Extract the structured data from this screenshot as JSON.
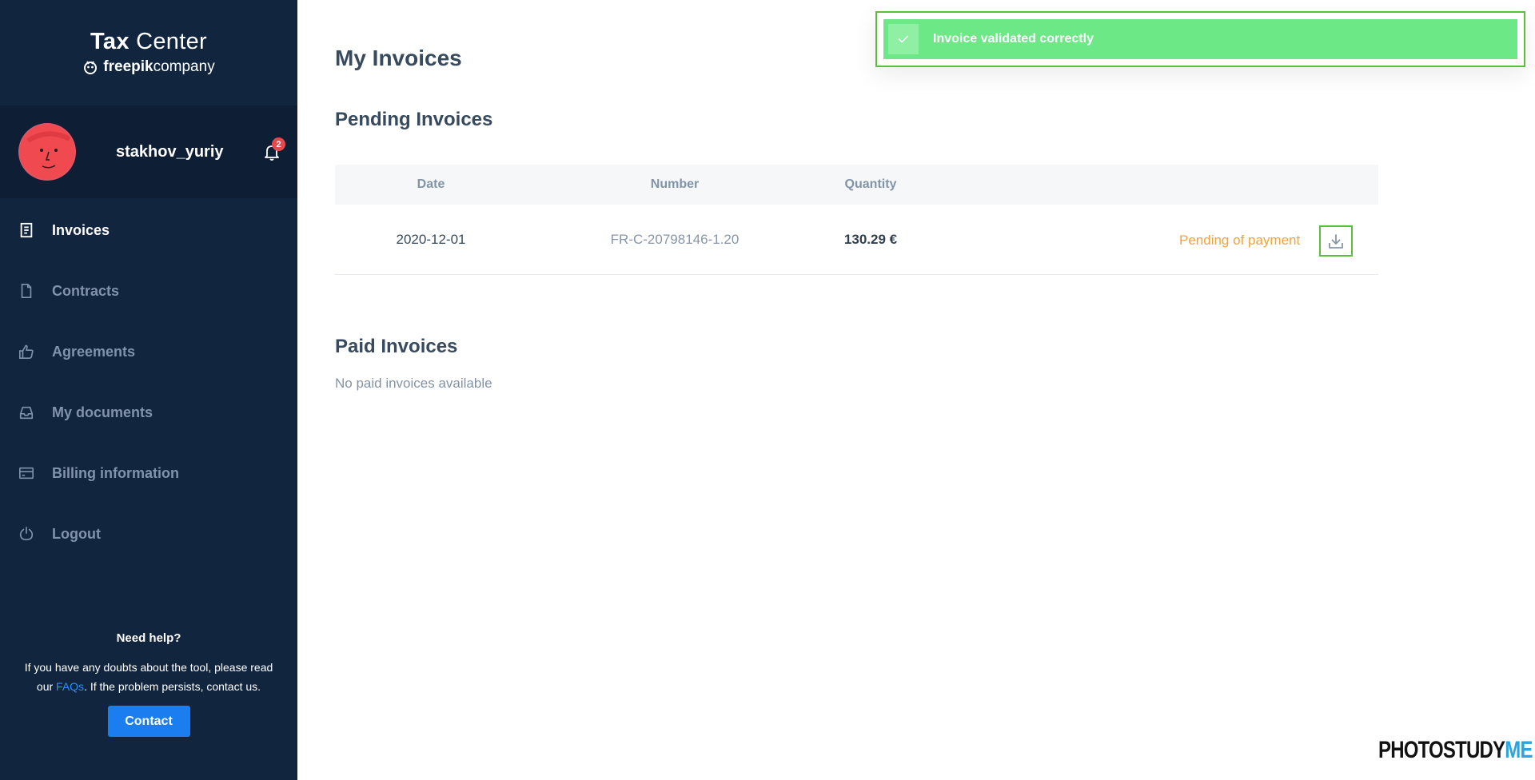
{
  "brand": {
    "title_bold": "Tax",
    "title_rest": " Center",
    "sub_bold": "freepik",
    "sub_rest": "company"
  },
  "user": {
    "name": "stakhov_yuriy",
    "notifications": "2"
  },
  "nav": {
    "items": [
      {
        "label": "Invoices",
        "icon": "invoice-icon",
        "active": true
      },
      {
        "label": "Contracts",
        "icon": "document-icon"
      },
      {
        "label": "Agreements",
        "icon": "thumbs-up-icon"
      },
      {
        "label": "My documents",
        "icon": "inbox-icon"
      },
      {
        "label": "Billing information",
        "icon": "credit-card-icon"
      },
      {
        "label": "Logout",
        "icon": "power-icon"
      }
    ]
  },
  "help": {
    "title": "Need help?",
    "text_before": "If you have any doubts about the tool, please read our ",
    "faq_link": "FAQs",
    "text_after": ". If the problem persists, contact us.",
    "contact_label": "Contact"
  },
  "main": {
    "title": "My Invoices",
    "pending": {
      "title": "Pending Invoices",
      "columns": [
        "Date",
        "Number",
        "Quantity"
      ],
      "rows": [
        {
          "date": "2020-12-01",
          "number": "FR-C-20798146-1.20",
          "quantity": "130.29 €",
          "status": "Pending of payment"
        }
      ]
    },
    "paid": {
      "title": "Paid Invoices",
      "empty_text": "No paid invoices available"
    }
  },
  "toast": {
    "message": "Invoice validated correctly"
  },
  "watermark": {
    "part1": "PHOTOSTUDY",
    "part2": "ME"
  },
  "colors": {
    "sidebar_bg": "#11253f",
    "accent_blue": "#1a7ef0",
    "pending_orange": "#f2a33a",
    "toast_green": "#6de886",
    "highlight_green": "#5bbf3c"
  }
}
